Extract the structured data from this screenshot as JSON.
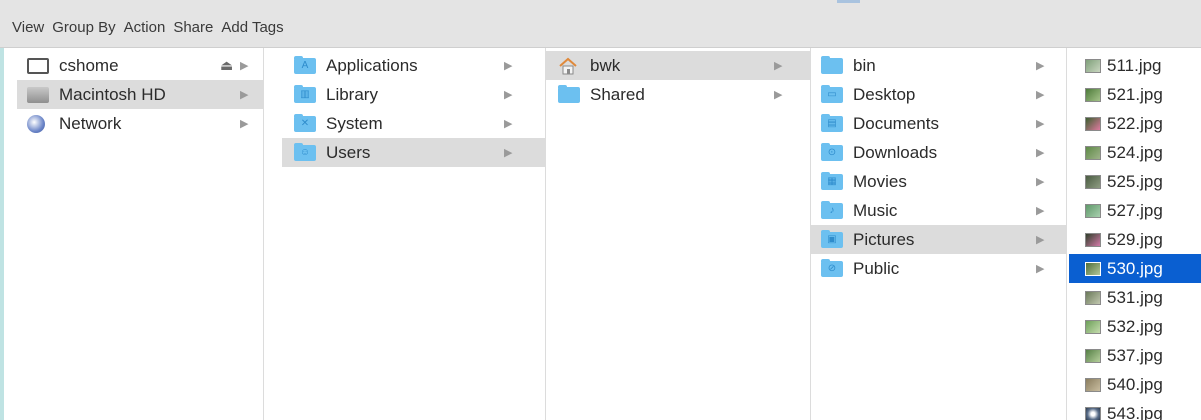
{
  "toolbar": {
    "items": [
      "View",
      "Group By",
      "Action",
      "Share",
      "Add Tags"
    ]
  },
  "columns": {
    "devices": [
      {
        "label": "cshome",
        "icon": "server-icon",
        "eject": "⏏"
      },
      {
        "label": "Macintosh HD",
        "icon": "hard-drive-icon"
      },
      {
        "label": "Network",
        "icon": "network-globe-icon"
      }
    ],
    "root": [
      {
        "label": "Applications",
        "icon": "applications-folder-icon"
      },
      {
        "label": "Library",
        "icon": "library-folder-icon"
      },
      {
        "label": "System",
        "icon": "system-folder-icon"
      },
      {
        "label": "Users",
        "icon": "users-folder-icon"
      }
    ],
    "users": [
      {
        "label": "bwk",
        "icon": "home-icon"
      },
      {
        "label": "Shared",
        "icon": "folder-icon"
      }
    ],
    "home": [
      {
        "label": "bin",
        "icon": "folder-icon"
      },
      {
        "label": "Desktop",
        "icon": "desktop-folder-icon"
      },
      {
        "label": "Documents",
        "icon": "documents-folder-icon"
      },
      {
        "label": "Downloads",
        "icon": "downloads-folder-icon"
      },
      {
        "label": "Movies",
        "icon": "movies-folder-icon"
      },
      {
        "label": "Music",
        "icon": "music-folder-icon"
      },
      {
        "label": "Pictures",
        "icon": "pictures-folder-icon"
      },
      {
        "label": "Public",
        "icon": "public-folder-icon"
      }
    ],
    "pictures": [
      {
        "label": "511.jpg"
      },
      {
        "label": "521.jpg"
      },
      {
        "label": "522.jpg"
      },
      {
        "label": "524.jpg"
      },
      {
        "label": "525.jpg"
      },
      {
        "label": "527.jpg"
      },
      {
        "label": "529.jpg"
      },
      {
        "label": "530.jpg"
      },
      {
        "label": "531.jpg"
      },
      {
        "label": "532.jpg"
      },
      {
        "label": "537.jpg"
      },
      {
        "label": "540.jpg"
      },
      {
        "label": "543.jpg"
      }
    ]
  },
  "selection": {
    "devices": "Macintosh HD",
    "root": "Users",
    "users": "bwk",
    "home": "Pictures",
    "pictures": "530.jpg"
  },
  "colors": {
    "selection_active": "#0a5fd1",
    "selection_inactive": "#dcdcdc",
    "folder": "#6cc0f0"
  }
}
